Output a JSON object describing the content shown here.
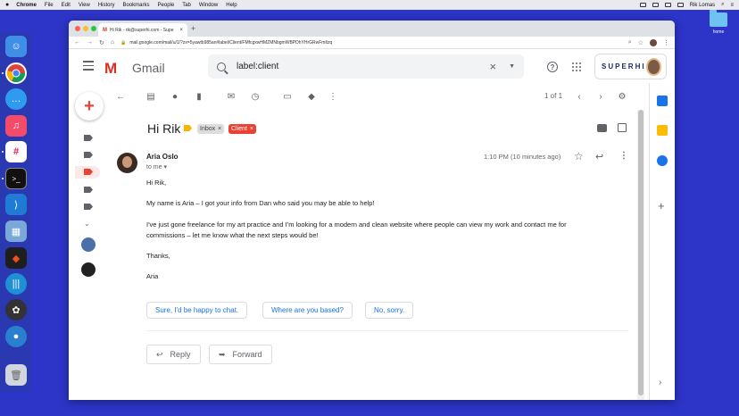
{
  "menubar": {
    "app": "Chrome",
    "items": [
      "File",
      "Edit",
      "View",
      "History",
      "Bookmarks",
      "People",
      "Tab",
      "Window",
      "Help"
    ],
    "user": "Rik Lomas"
  },
  "desktop": {
    "folder_label": "home"
  },
  "browser": {
    "tab_title": "Hi Rik - rik@superhi.com - Supe",
    "url": "mail.google.com/mail/u/1/?zx=5yawtb985an#label/Client/FMfcgxwHMZMNbgmWBPDhYHrGRwFmltzq"
  },
  "gmail": {
    "logo_text": "Gmail",
    "search_value": "label:client",
    "brand": "SUPERHI",
    "pager": "1 of 1"
  },
  "message": {
    "subject": "Hi Rik",
    "labels": [
      "Inbox",
      "Client"
    ],
    "sender": "Aria Oslo",
    "to": "to me",
    "time": "1:10 PM (10 minutes ago)",
    "greeting": "Hi Rik,",
    "p1": "My name is Aria – I got your info from Dan who said you may be able to help!",
    "p2a": "I've just gone freelance for my art practice and I'm looking for a modern and clean website where people can view my work and contact me for",
    "p2b": "commissions – let me know what the next steps would be!",
    "thanks": "Thanks,",
    "signoff": "Aria"
  },
  "smart_replies": [
    "Sure, I'd be happy to chat.",
    "Where are you based?",
    "No, sorry."
  ],
  "actions": {
    "reply": "Reply",
    "forward": "Forward"
  },
  "colors": {
    "gmail_red": "#d93025",
    "client_label": "#e94235",
    "link_blue": "#1a73e8"
  }
}
